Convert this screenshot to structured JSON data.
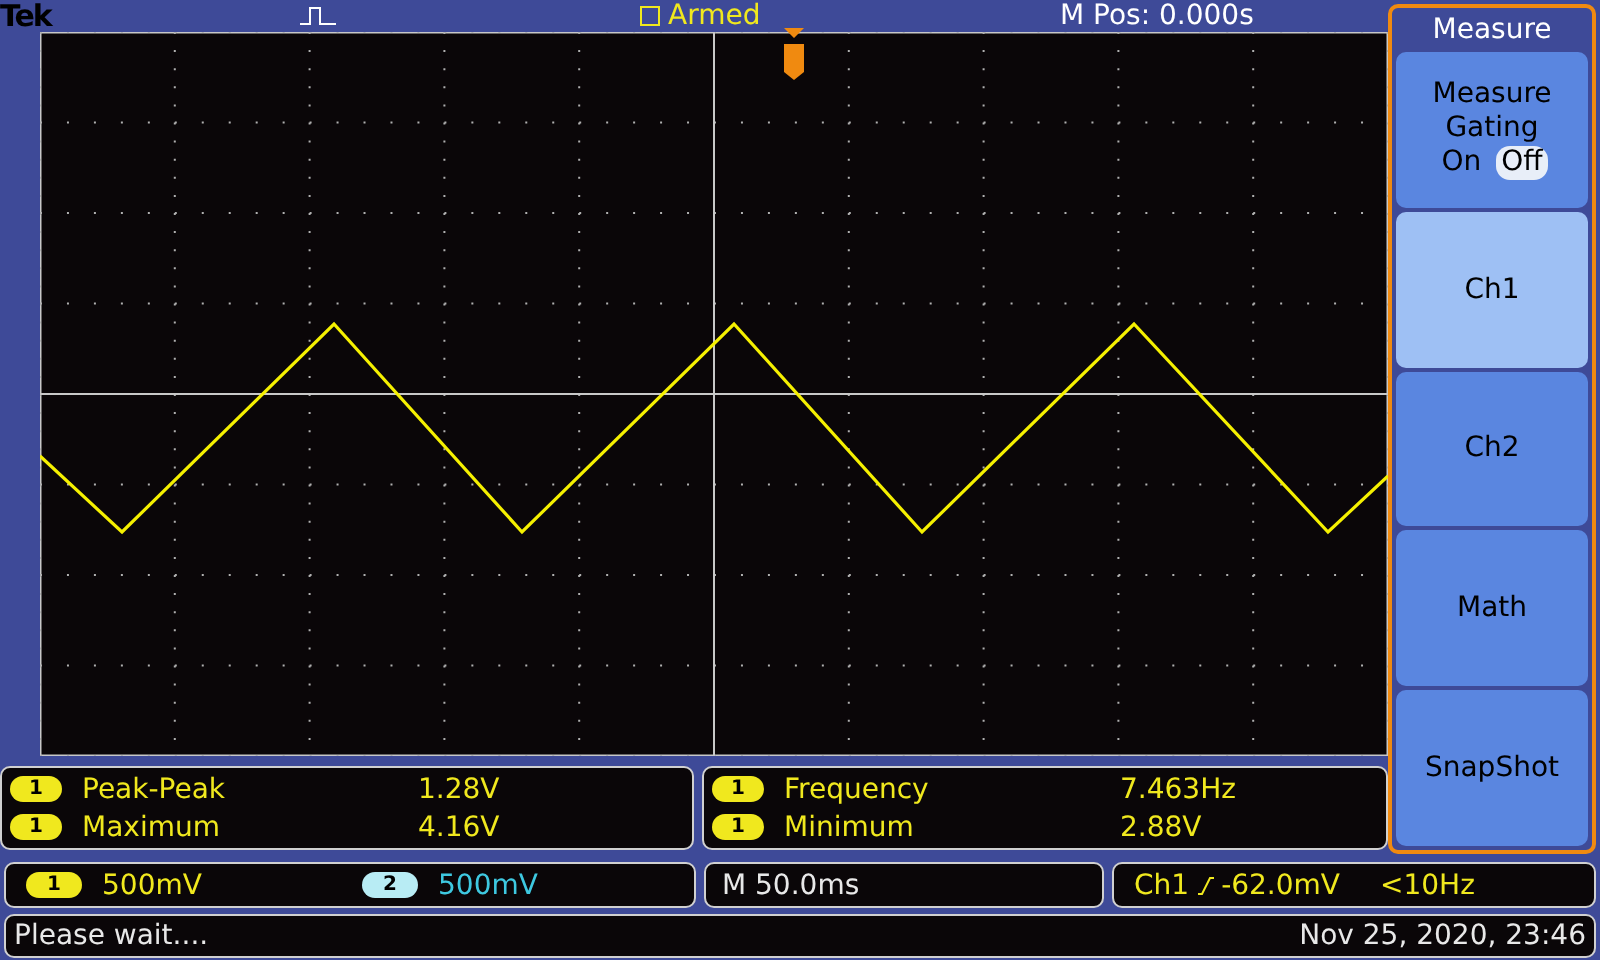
{
  "top_bar": {
    "brand": "Tek",
    "trigger_status": "Armed",
    "position": "M Pos: 0.000s"
  },
  "side_menu": {
    "title": "Measure",
    "items": [
      {
        "kind": "toggle",
        "label": "Measure Gating",
        "options": [
          {
            "label": "On",
            "selected": false
          },
          {
            "label": "Off",
            "selected": true
          }
        ],
        "selected": false
      },
      {
        "kind": "button",
        "label": "Ch1",
        "selected": true
      },
      {
        "kind": "button",
        "label": "Ch2",
        "selected": false
      },
      {
        "kind": "button",
        "label": "Math",
        "selected": false
      },
      {
        "kind": "button",
        "label": "SnapShot",
        "selected": false
      }
    ]
  },
  "measurements": [
    [
      {
        "channel": "1",
        "color": "#f0e81e",
        "name": "Peak-Peak",
        "value": "1.28V"
      },
      {
        "channel": "1",
        "color": "#f0e81e",
        "name": "Maximum",
        "value": "4.16V"
      }
    ],
    [
      {
        "channel": "1",
        "color": "#f0e81e",
        "name": "Frequency",
        "value": "7.463Hz"
      },
      {
        "channel": "1",
        "color": "#f0e81e",
        "name": "Minimum",
        "value": "2.88V"
      }
    ]
  ],
  "channels": [
    {
      "channel": "1",
      "color": "#f0e81e",
      "scale": "500mV"
    },
    {
      "channel": "2",
      "color": "#b8ecf4",
      "scale": "500mV"
    }
  ],
  "timebase": "M 50.0ms",
  "trigger": {
    "source": "Ch1",
    "level": "-62.0mV",
    "frequency": "<10Hz"
  },
  "status_bar": {
    "message": "Please wait....",
    "datetime": "Nov 25, 2020, 23:46"
  }
}
